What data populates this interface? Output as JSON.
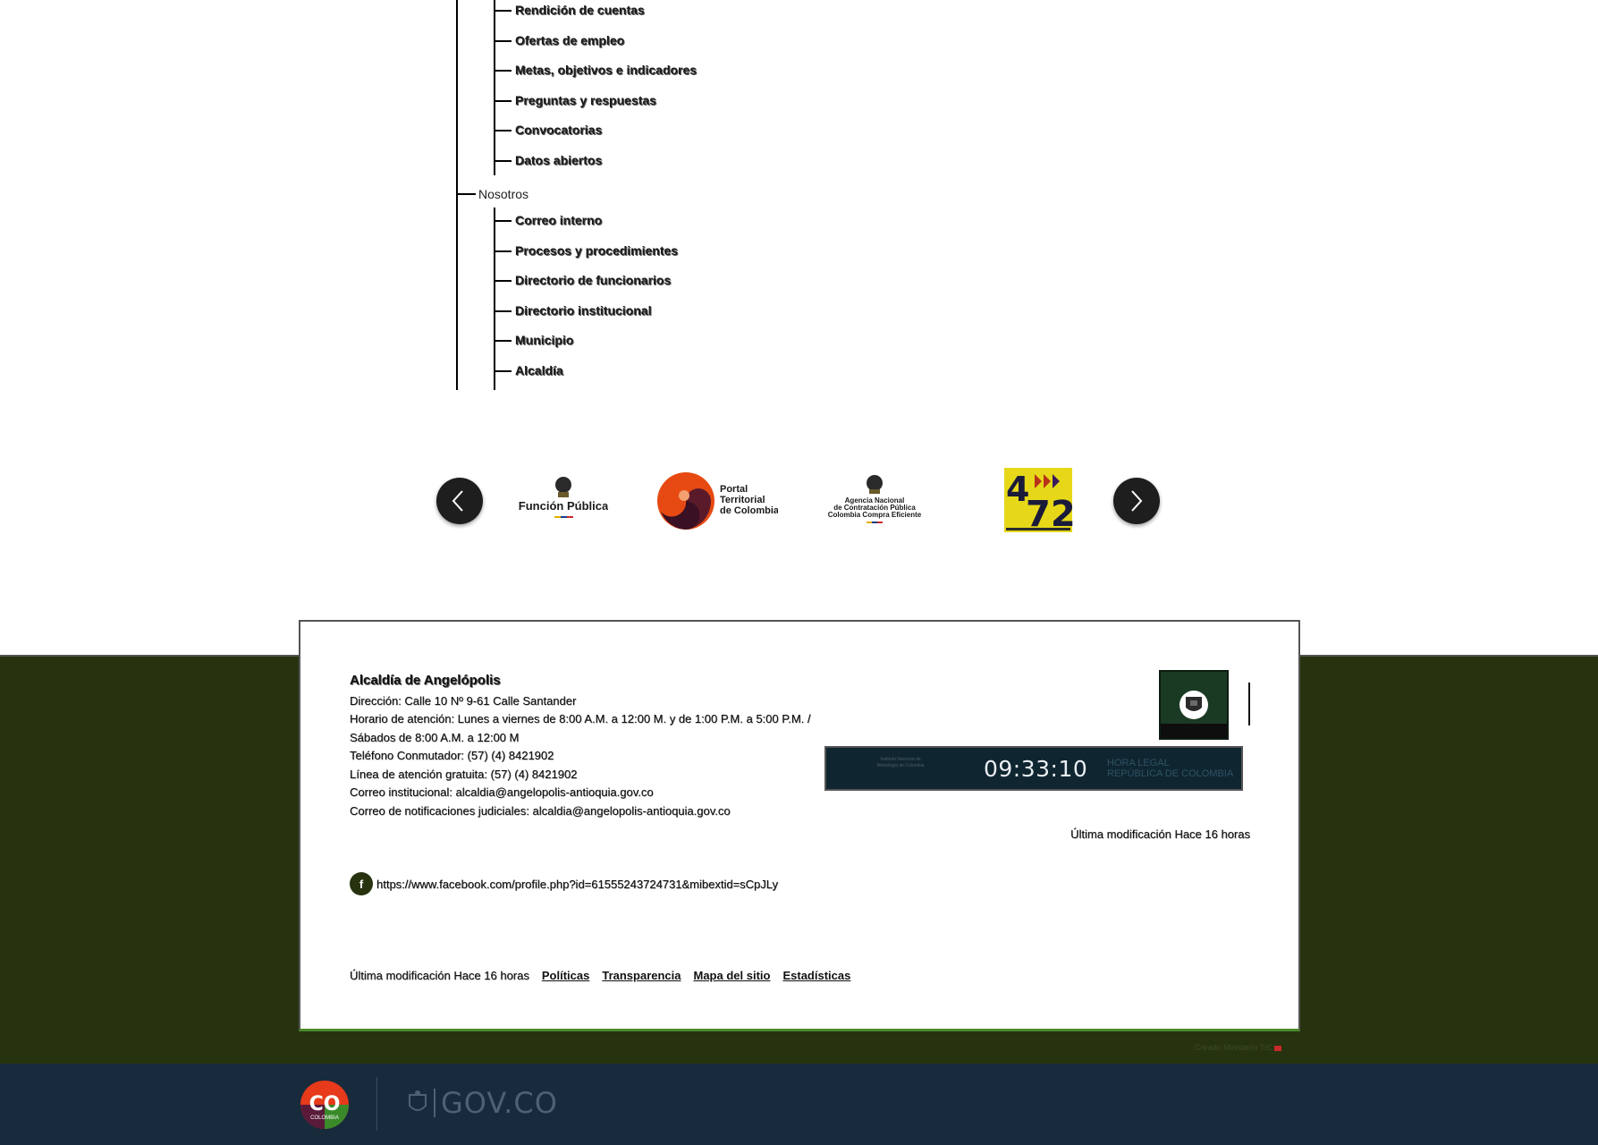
{
  "sitemap": {
    "group1_items": [
      "Rendición de cuentas",
      "Ofertas de empleo",
      "Metas, objetivos e indicadores",
      "Preguntas y respuestas",
      "Convocatorias",
      "Datos abiertos"
    ],
    "group2_label": "Nosotros",
    "group2_items": [
      "Correo interno",
      "Procesos y procedimientes",
      "Directorio de funcionarios",
      "Directorio institucional",
      "Municipio",
      "Alcaldía"
    ]
  },
  "carousel": {
    "logos": [
      {
        "name": "Función Pública"
      },
      {
        "name": "Portal Territorial de Colombia"
      },
      {
        "name": "Agencia Nacional de Contratación Pública Colombia Compra Eficiente"
      },
      {
        "name": "4-72"
      }
    ]
  },
  "footer": {
    "title": "Alcaldía de Angelópolis",
    "address": "Dirección: Calle 10 Nº 9-61 Calle Santander",
    "hours_1": "Horario de atención: Lunes a viernes de 8:00 A.M. a 12:00 M. y de 1:00 P.M. a 5:00 P.M. /",
    "hours_2": "Sábados de 8:00 A.M. a 12:00 M",
    "phone": "Teléfono Conmutador: (57) (4) 8421902",
    "free_line": "Línea de atención gratuita: (57) (4) 8421902",
    "email": "Correo institucional: alcaldia@angelopolis-antioquia.gov.co",
    "email_legal": "Correo de notificaciones judiciales: alcaldia@angelopolis-antioquia.gov.co",
    "facebook_icon": "f",
    "facebook_url": "https://www.facebook.com/profile.php?id=61555243724731&mibextid=sCpJLy",
    "last_modified_right": "Última modificación Hace 16 horas",
    "last_modified_bottom": "Última modificación Hace 16 horas",
    "links": [
      "Políticas",
      "Transparencia",
      "Mapa del sitio",
      "Estadísticas"
    ],
    "credit": "Creado Ministerio TIC"
  },
  "clock": {
    "time": "09:33:10",
    "label_1": "HORA LEGAL",
    "label_2": "REPÚBLICA DE COLOMBIA",
    "institute": "Instituto Nacional de Metrología de Colombia"
  },
  "govbar": {
    "co_text": "CO",
    "co_sub": "COLOMBIA",
    "gov_text": "GOV.CO"
  },
  "colors": {
    "footer_green": "#27330f",
    "gov_blue": "#172b3c",
    "clock_bg": "#0f2530"
  }
}
